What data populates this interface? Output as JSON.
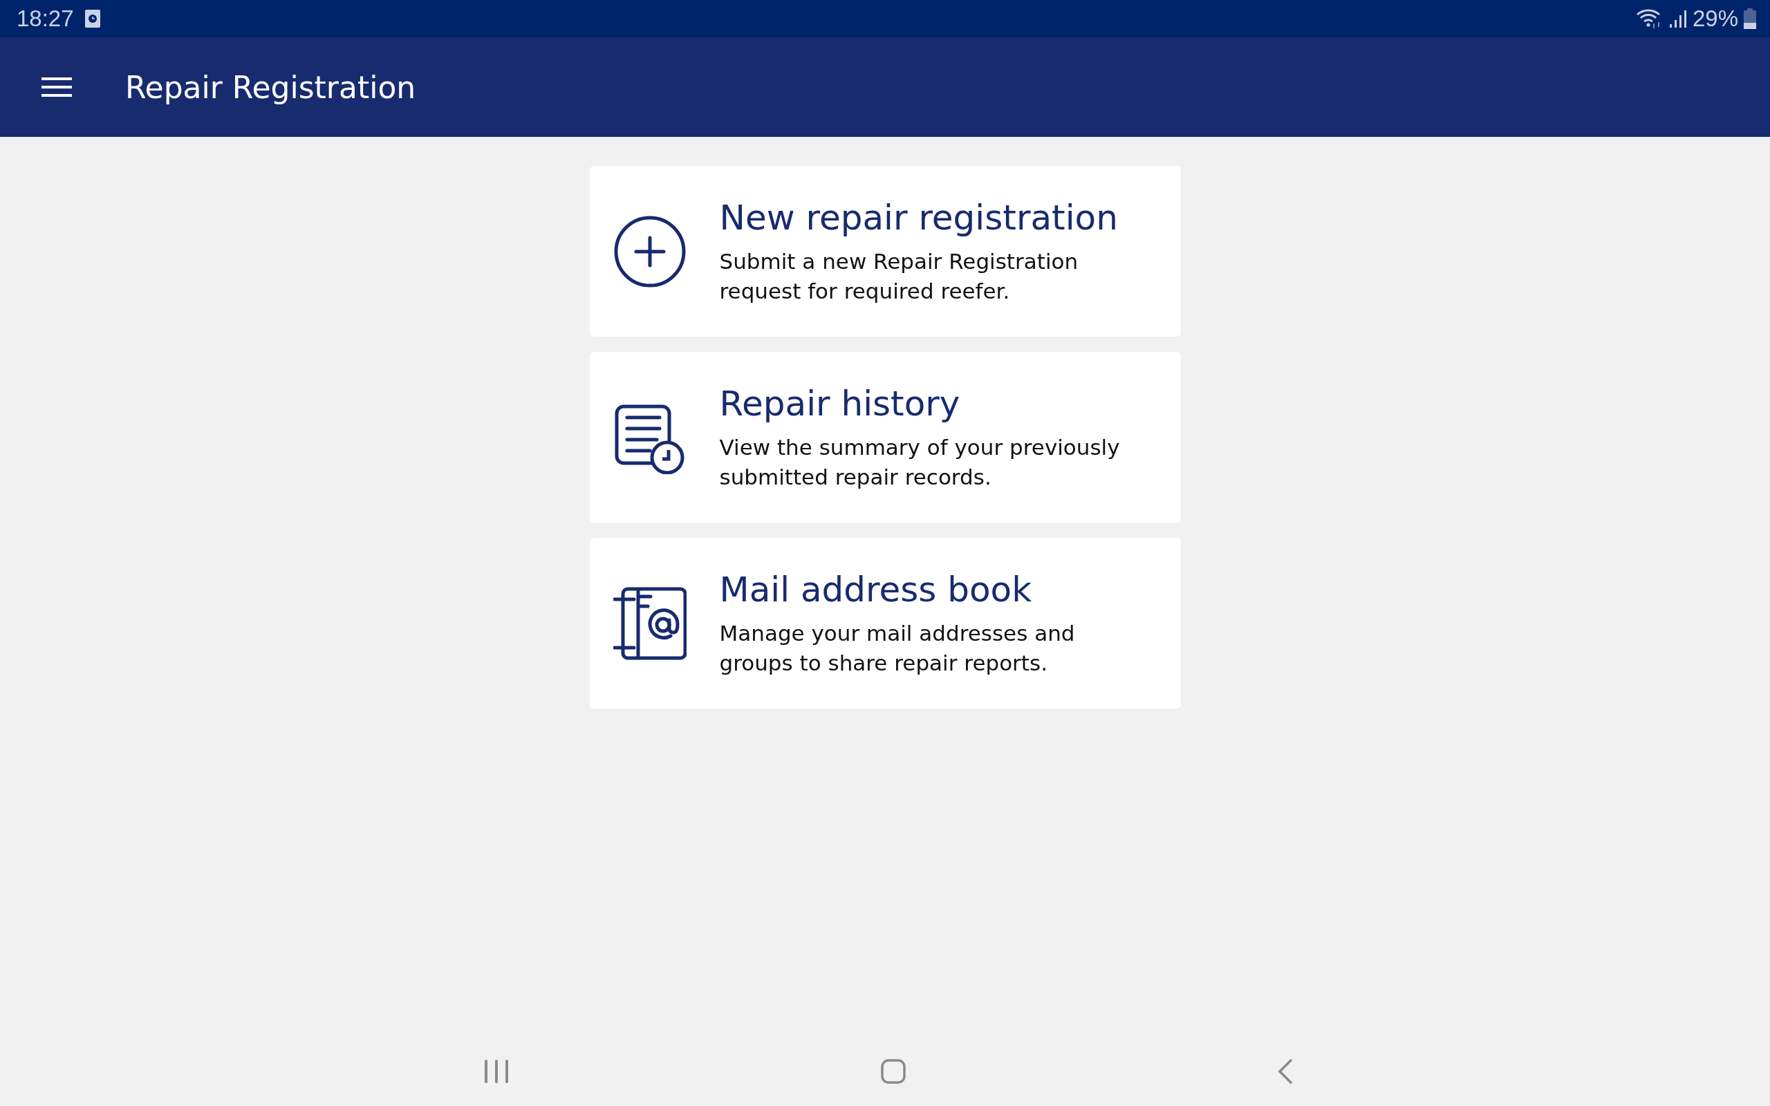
{
  "status_bar": {
    "time": "18:27",
    "battery": "29%"
  },
  "app_bar": {
    "title": "Repair Registration"
  },
  "cards": [
    {
      "kind": "new",
      "title": "New repair registration",
      "description": "Submit a new Repair Registration request for required reefer."
    },
    {
      "kind": "history",
      "title": "Repair history",
      "description": "View the summary of your previously submitted repair records."
    },
    {
      "kind": "addressbook",
      "title": "Mail address book",
      "description": "Manage your mail addresses and groups to share repair reports."
    }
  ]
}
